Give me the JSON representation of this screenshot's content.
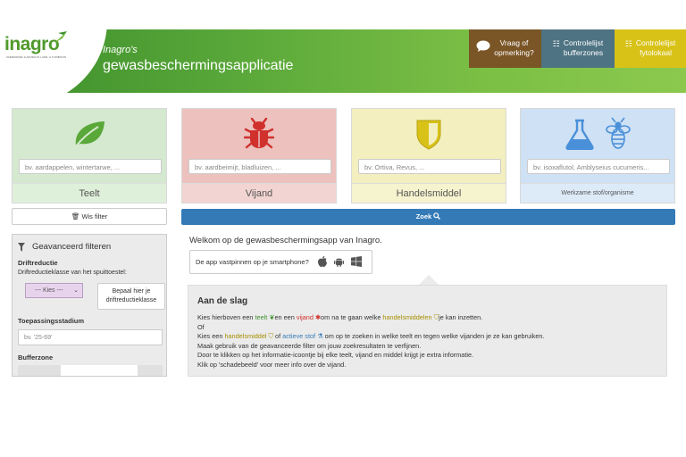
{
  "header": {
    "logo_text": "inagro",
    "logo_tagline": "ONDERZOEK & ADVIES IN LAND- & TUINBOUW",
    "app_subtitle": "Inagro's",
    "app_title": "gewasbeschermingsapplicatie",
    "buttons": [
      {
        "label_line1": "Vraag of",
        "label_line2": "opmerking?",
        "icon": "speech-bubble-icon"
      },
      {
        "label_line1": "Controlelijst",
        "label_line2": "bufferzones",
        "icon": "list-icon"
      },
      {
        "label_line1": "Controlelijst",
        "label_line2": "fytolokaal",
        "icon": "list-icon"
      }
    ]
  },
  "cards": {
    "teelt": {
      "placeholder": "bv. aardappelen, wintertarwe, ...",
      "label": "Teelt",
      "icon": "leaf-icon",
      "color": "#5aa83a"
    },
    "vijand": {
      "placeholder": "bv. aardbeimijt, bladluizen, ...",
      "label": "Vijand",
      "icon": "bug-icon",
      "color": "#d0312d"
    },
    "handelsmiddel": {
      "placeholder": "bv. Ortiva, Revus, ...",
      "label": "Handelsmiddel",
      "icon": "shield-icon",
      "color": "#d8c218"
    },
    "werkzame": {
      "placeholder": "bv. isoxaflutol, Amblyseius cucumeris...",
      "label": "Werkzame stof/organisme",
      "icons": [
        "flask-icon",
        "bee-icon"
      ],
      "color": "#4a90d9"
    }
  },
  "wis_filter": "Wis filter",
  "zoek": "Zoek",
  "filter": {
    "title": "Geavanceerd filteren",
    "driftreductie_heading": "Driftreductie",
    "driftreductie_text": "Driftreductieklasse van het spuittoestel:",
    "select_value": "--- Kies ---",
    "bepaal_line1": "Bepaal hier je",
    "bepaal_line2": "driftreductieklasse",
    "toepassing_heading": "Toepassingsstadium",
    "toepassing_placeholder": "bv. '25-69'",
    "bufferzone_heading": "Bufferzone"
  },
  "main": {
    "welkom": "Welkom op de gewasbeschermingsapp van Inagro.",
    "app_pin": "De app vastpinnen op je smartphone?",
    "aan_de_slag": "Aan de slag",
    "line1": {
      "a": "Kies hierboven een ",
      "teelt": "teelt",
      "b": "en een ",
      "vijand": "vijand",
      "c": "om na te gaan welke ",
      "handel": "handelsmiddelen",
      "d": "je kan inzetten."
    },
    "line2": "Of",
    "line3": {
      "a": "Kies een ",
      "handel": "handelsmiddel",
      "b": " of ",
      "stof": "actieve stof",
      "c": " om op te zoeken in welke teelt en tegen welke vijanden je ze kan gebruiken."
    },
    "line4": "Maak gebruik van de geavanceerde filter om jouw zoekresultaten te verfijnen.",
    "line5": "Door te klikken op het informatie-icoontje bij elke teelt, vijand en middel krijgt je extra informatie.",
    "line6": "Klik op 'schadebeeld' voor meer info over de vijand."
  }
}
